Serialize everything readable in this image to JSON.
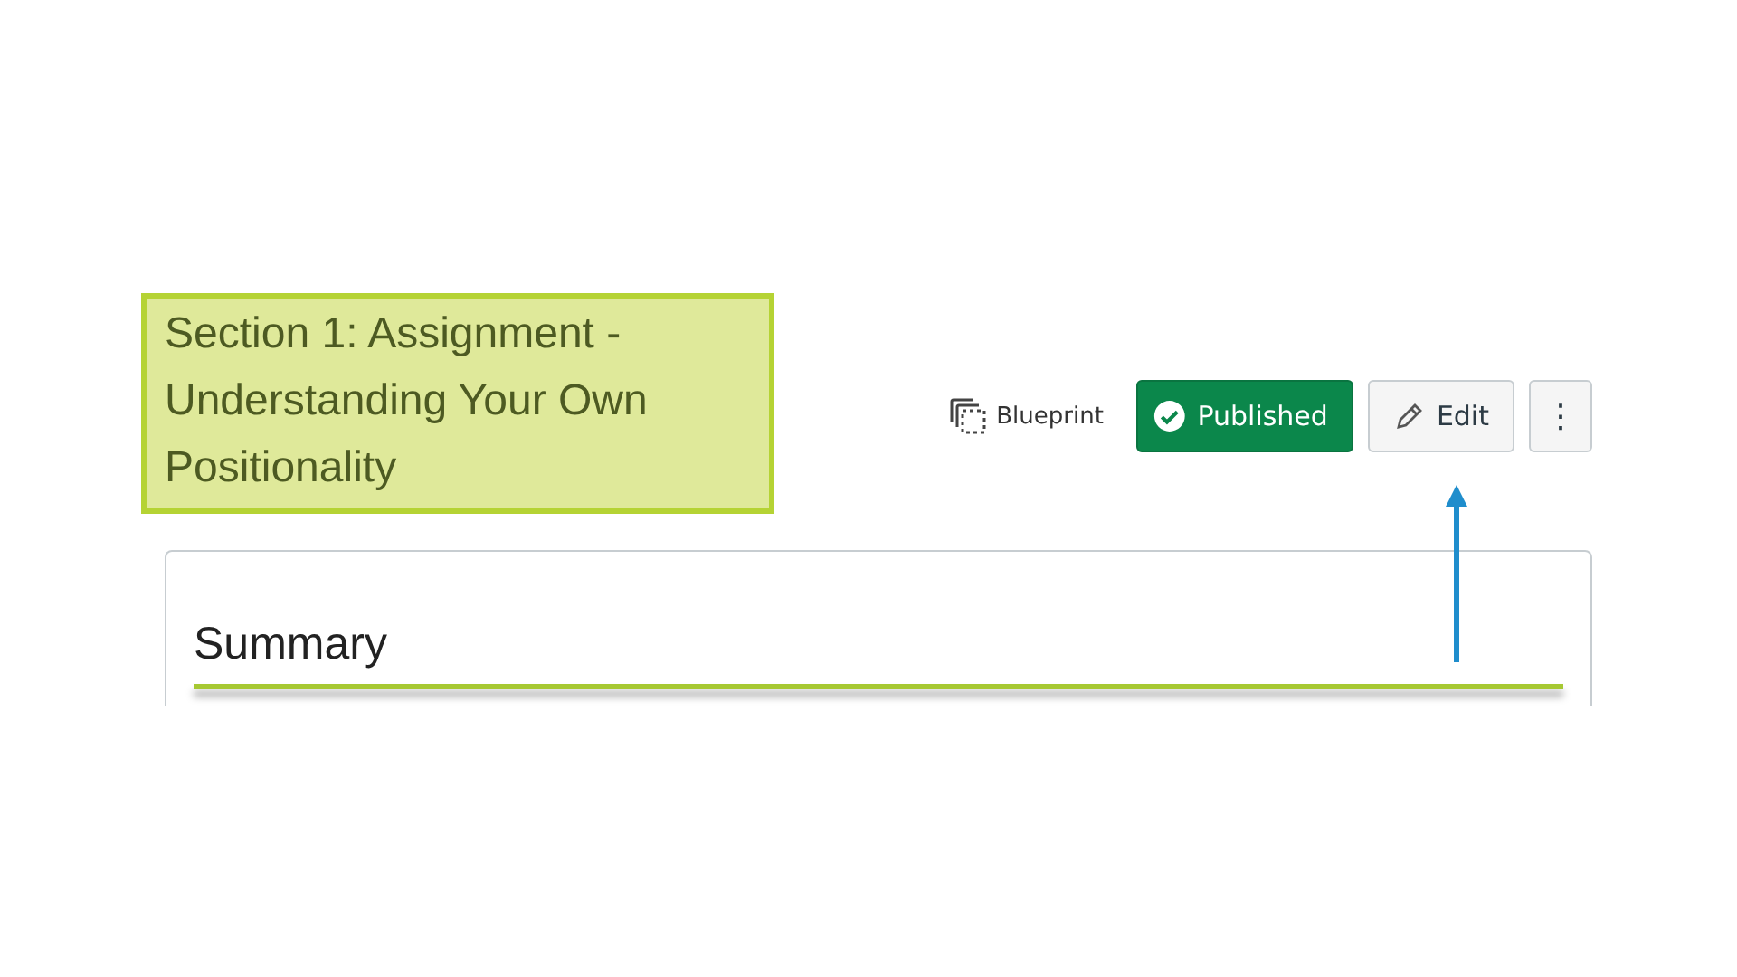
{
  "title": "Section 1: Assignment - Understanding Your Own Positionality",
  "toolbar": {
    "blueprint": "Blueprint",
    "published": true,
    "status": "Published",
    "edit": "Edit",
    "more": "⋮"
  },
  "card": {
    "heading": "Summary"
  }
}
